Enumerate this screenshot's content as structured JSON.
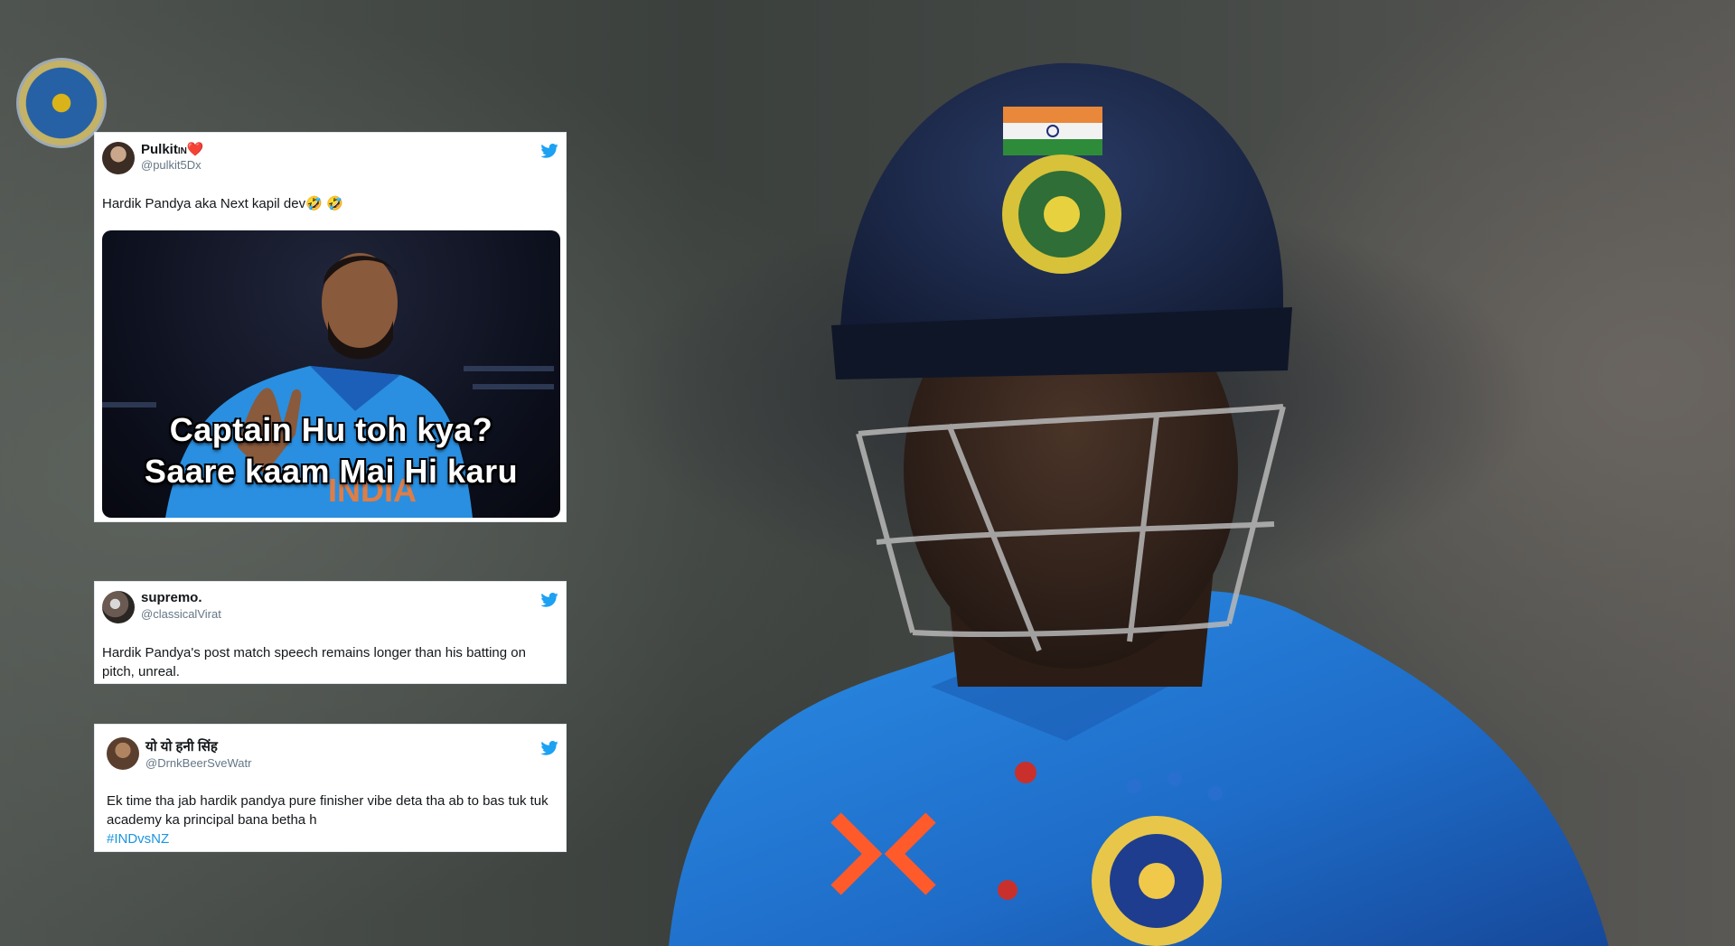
{
  "tweets": [
    {
      "name": "Pulkit",
      "name_suffix": "IN",
      "heart": "❤️",
      "handle": "@pulkit5Dx",
      "text": "Hardik Pandya aka Next kapil dev🤣 🤣",
      "meme": {
        "caption_line1": "Captain Hu toh kya?",
        "caption_line2": "Saare kaam Mai Hi karu",
        "jersey_text": "INDIA"
      }
    },
    {
      "name": "supremo.",
      "handle": "@classicalVirat",
      "text": "Hardik Pandya's post match speech remains longer than his batting on pitch, unreal."
    },
    {
      "name": "यो यो हनी सिंह",
      "handle": "@DrnkBeerSveWatr",
      "text": "Ek time tha jab hardik pandya pure finisher vibe deta tha ab to bas tuk tuk academy ka principal bana betha h",
      "hashtag": "#INDvsNZ"
    }
  ],
  "colors": {
    "twitter_blue": "#1da1f2",
    "jersey_blue": "#1f7fd6",
    "helmet_navy": "#1d2a4d"
  },
  "icons": [
    "bcci-crest-icon",
    "twitter-bird-icon"
  ]
}
